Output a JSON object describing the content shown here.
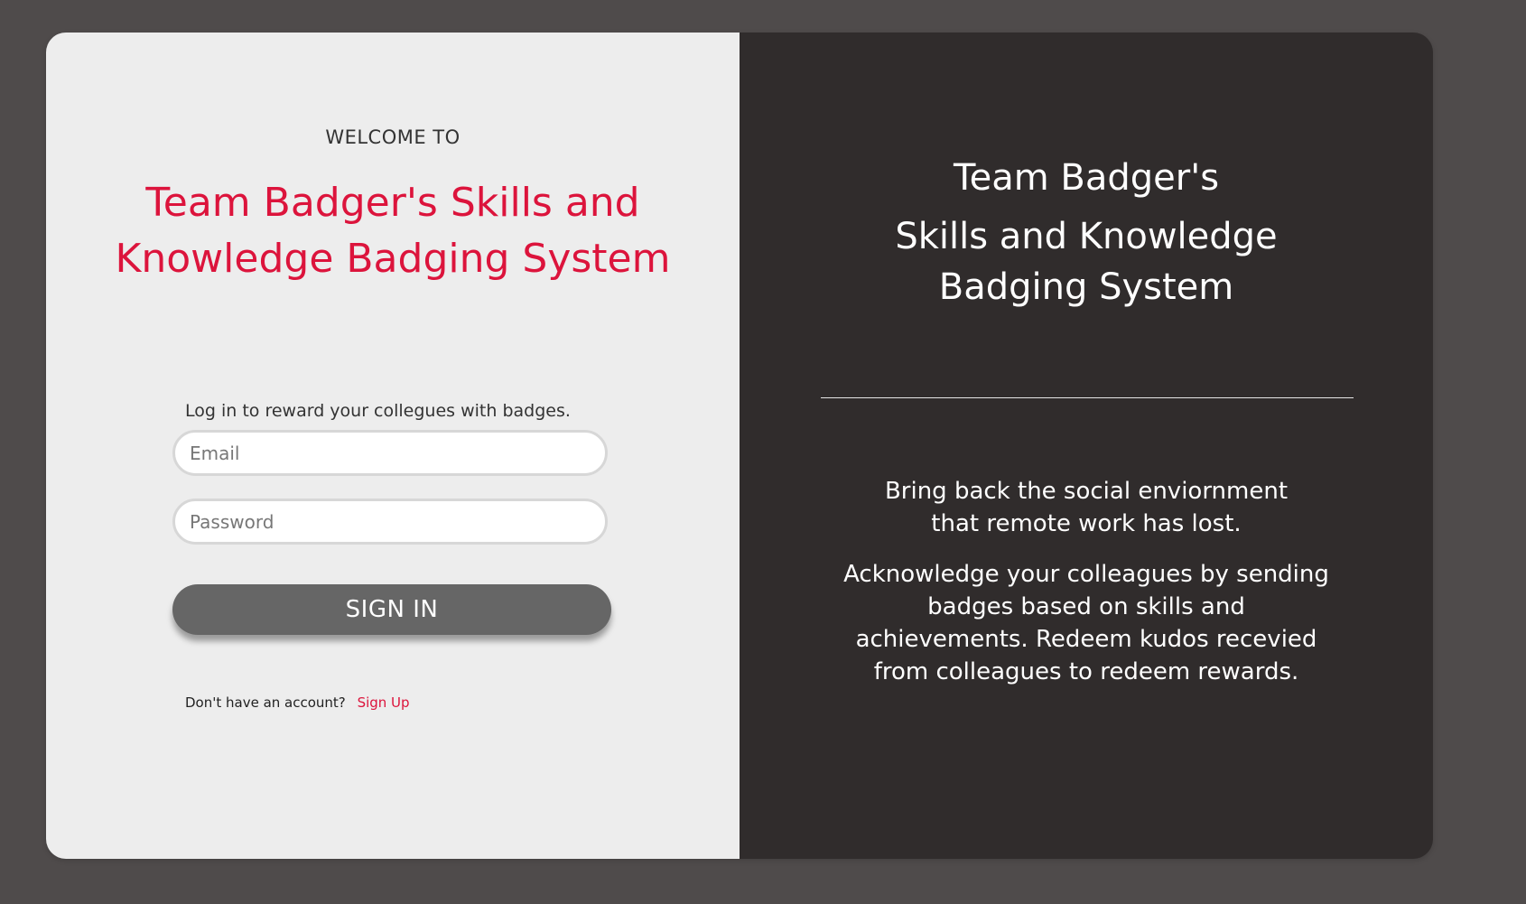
{
  "login": {
    "welcome_label": "WELCOME TO",
    "title": "Team Badger's Skills and Knowledge Badging System",
    "prompt": "Log in to reward your collegues with badges.",
    "email_placeholder": "Email",
    "password_placeholder": "Password",
    "sign_in_label": "SIGN IN",
    "no_account_text": "Don't have an account?",
    "sign_up_link": "Sign Up"
  },
  "info": {
    "title_line1": "Team Badger's",
    "title_line2": "Skills and Knowledge Badging System",
    "tagline": "Bring back the social enviornment that remote work has lost.",
    "description": "Acknowledge your colleagues by sending badges based on skills and achievements. Redeem kudos recevied from colleagues to redeem rewards."
  },
  "colors": {
    "page_background": "#4f4b4b",
    "left_panel": "#ededed",
    "right_panel": "#302c2c",
    "accent": "#dc143c",
    "button": "#666666"
  }
}
